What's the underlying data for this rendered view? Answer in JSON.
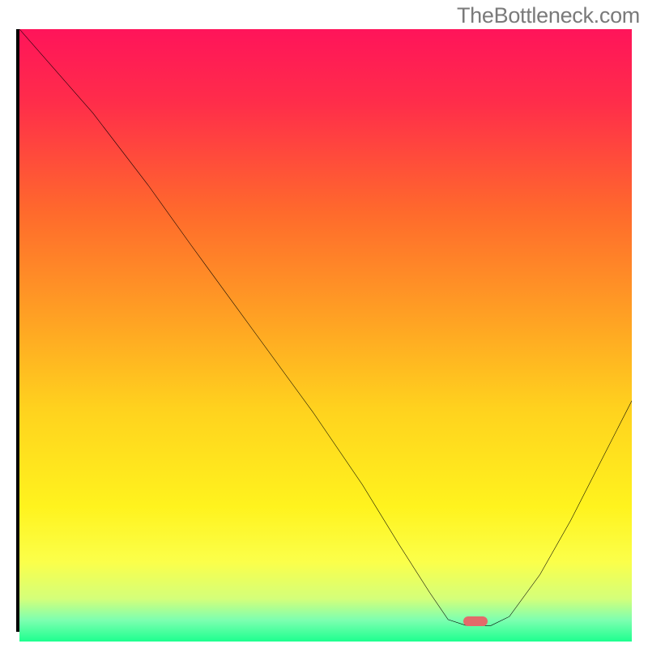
{
  "watermark": "TheBottleneck.com",
  "chart_data": {
    "type": "line",
    "title": "",
    "xlabel": "",
    "ylabel": "",
    "xlim": [
      0,
      100
    ],
    "ylim": [
      0,
      100
    ],
    "gradient_stops": [
      {
        "pos": 0.0,
        "color": "#ff145a"
      },
      {
        "pos": 0.12,
        "color": "#ff2d4a"
      },
      {
        "pos": 0.3,
        "color": "#ff6a2c"
      },
      {
        "pos": 0.48,
        "color": "#ffa423"
      },
      {
        "pos": 0.62,
        "color": "#ffd21e"
      },
      {
        "pos": 0.78,
        "color": "#fff31e"
      },
      {
        "pos": 0.87,
        "color": "#fbff4a"
      },
      {
        "pos": 0.93,
        "color": "#d4ff7a"
      },
      {
        "pos": 0.965,
        "color": "#7dffb0"
      },
      {
        "pos": 1.0,
        "color": "#1dff8f"
      }
    ],
    "curve_points": [
      {
        "x": 0,
        "y": 100
      },
      {
        "x": 12,
        "y": 86
      },
      {
        "x": 21,
        "y": 74
      },
      {
        "x": 28,
        "y": 64
      },
      {
        "x": 38,
        "y": 50
      },
      {
        "x": 48,
        "y": 36
      },
      {
        "x": 56,
        "y": 24
      },
      {
        "x": 62,
        "y": 14
      },
      {
        "x": 67,
        "y": 6
      },
      {
        "x": 70,
        "y": 1.5
      },
      {
        "x": 73,
        "y": 0.5
      },
      {
        "x": 77,
        "y": 0.5
      },
      {
        "x": 80,
        "y": 2
      },
      {
        "x": 85,
        "y": 9
      },
      {
        "x": 90,
        "y": 18
      },
      {
        "x": 95,
        "y": 28
      },
      {
        "x": 100,
        "y": 38
      }
    ],
    "marker": {
      "x": 74.5,
      "y": 0.4,
      "width": 4.0,
      "height": 1.6,
      "color": "#e26a6a"
    }
  }
}
